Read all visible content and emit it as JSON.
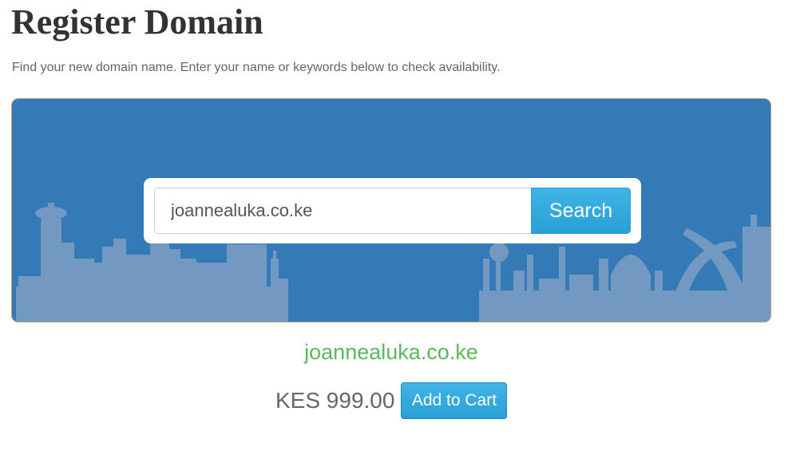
{
  "header": {
    "title": "Register Domain",
    "subtitle": "Find your new domain name. Enter your name or keywords below to check availability."
  },
  "search": {
    "value": "joannealuka.co.ke",
    "button_label": "Search"
  },
  "result": {
    "domain": "joannealuka.co.ke",
    "price": "KES 999.00",
    "add_to_cart_label": "Add to Cart"
  },
  "colors": {
    "banner": "#337ab7",
    "skyline": "#7199c1",
    "search_button": "#2a9fd6",
    "available": "#5cb85c"
  }
}
